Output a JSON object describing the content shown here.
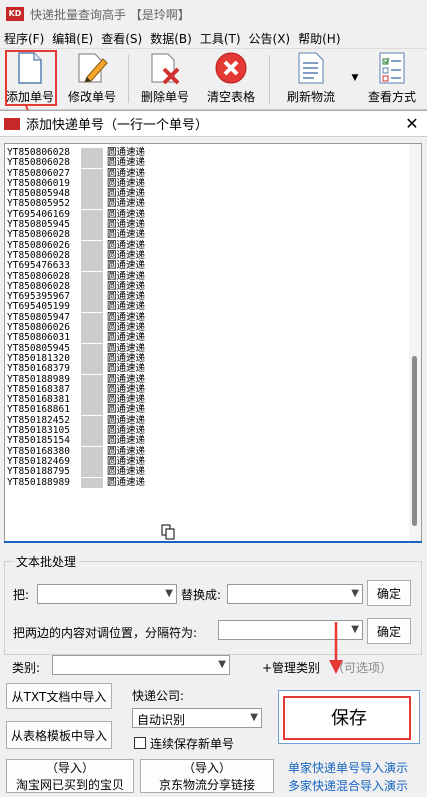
{
  "window": {
    "title": "快递批量查询高手 【是玲啊】",
    "icon_text": "KD"
  },
  "menu": [
    "程序(F)",
    "编辑(E)",
    "查看(S)",
    "数据(B)",
    "工具(T)",
    "公告(X)",
    "帮助(H)"
  ],
  "toolbar": {
    "add": "添加单号",
    "edit": "修改单号",
    "delete": "删除单号",
    "clear": "清空表格",
    "refresh": "刷新物流",
    "view": "查看方式"
  },
  "dialog": {
    "title": "添加快递单号（一行一个单号）",
    "rows": [
      {
        "num": "YT850806028",
        "courier": "圆通速递"
      },
      {
        "num": "YT850806028",
        "courier": "圆通速递"
      },
      {
        "num": "YT850806027",
        "courier": "圆通速递"
      },
      {
        "num": "YT850806019",
        "courier": "圆通速递"
      },
      {
        "num": "YT850805948",
        "courier": "圆通速递"
      },
      {
        "num": "YT850805952",
        "courier": "圆通速递"
      },
      {
        "num": "YT695406169",
        "courier": "圆通速递"
      },
      {
        "num": "YT850805945",
        "courier": "圆通速递"
      },
      {
        "num": "YT850806028",
        "courier": "圆通速递"
      },
      {
        "num": "YT850806026",
        "courier": "圆通速递"
      },
      {
        "num": "YT850806028",
        "courier": "圆通速递"
      },
      {
        "num": "YT695476633",
        "courier": "圆通速递"
      },
      {
        "num": "YT850806028",
        "courier": "圆通速递"
      },
      {
        "num": "YT850806028",
        "courier": "圆通速递"
      },
      {
        "num": "YT695395967",
        "courier": "圆通速递"
      },
      {
        "num": "YT695405199",
        "courier": "圆通速递"
      },
      {
        "num": "YT850805947",
        "courier": "圆通速递"
      },
      {
        "num": "YT850806026",
        "courier": "圆通速递"
      },
      {
        "num": "YT850806031",
        "courier": "圆通速递"
      },
      {
        "num": "YT850805945",
        "courier": "圆通速递"
      },
      {
        "num": "YT850181320",
        "courier": "圆通速递"
      },
      {
        "num": "YT850168379",
        "courier": "圆通速递"
      },
      {
        "num": "YT850188989",
        "courier": "圆通速递"
      },
      {
        "num": "YT850168387",
        "courier": "圆通速递"
      },
      {
        "num": "YT850168381",
        "courier": "圆通速递"
      },
      {
        "num": "YT850168861",
        "courier": "圆通速递"
      },
      {
        "num": "YT850182452",
        "courier": "圆通速递"
      },
      {
        "num": "YT850183105",
        "courier": "圆通速递"
      },
      {
        "num": "YT850185154",
        "courier": "圆通速递"
      },
      {
        "num": "YT850168380",
        "courier": "圆通速递"
      },
      {
        "num": "YT850182469",
        "courier": "圆通速递"
      },
      {
        "num": "YT850188795",
        "courier": "圆通速递"
      },
      {
        "num": "YT850188989",
        "courier": "圆通速递"
      }
    ]
  },
  "batch": {
    "legend": "文本批处理",
    "replace_label": "把:",
    "replace_with_label": "替换成:",
    "confirm": "确定",
    "swap_label": "把两边的内容对调位置，分隔符为:",
    "confirm2": "确定"
  },
  "category": {
    "label": "类别:",
    "manage": "+管理类别",
    "optional": "（可选项）"
  },
  "import": {
    "txt": "从TXT文档中导入",
    "excel": "从表格模板中导入",
    "taobao_line1": "（导入）",
    "taobao_line2": "淘宝网已买到的宝贝",
    "jd_line1": "（导入）",
    "jd_line2": "京东物流分享链接"
  },
  "courier": {
    "label": "快递公司:",
    "value": "自动识别",
    "continuous": "连续保存新单号"
  },
  "save": "保存",
  "links": {
    "single": "单家快递单号导入演示",
    "mixed": "多家快递混合导入演示"
  }
}
